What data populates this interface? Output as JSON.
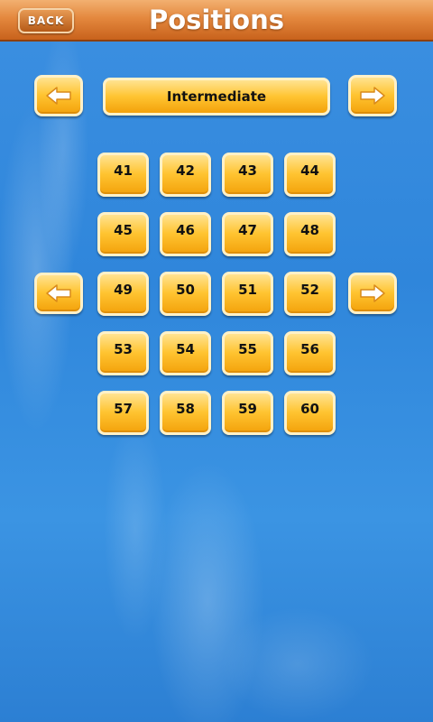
{
  "header": {
    "back_label": "BACK",
    "title": "Positions"
  },
  "level": {
    "name": "Intermediate",
    "prev_icon": "arrow-left-icon",
    "next_icon": "arrow-right-icon"
  },
  "page": {
    "prev_icon": "arrow-left-icon",
    "next_icon": "arrow-right-icon"
  },
  "positions": [
    "41",
    "42",
    "43",
    "44",
    "45",
    "46",
    "47",
    "48",
    "49",
    "50",
    "51",
    "52",
    "53",
    "54",
    "55",
    "56",
    "57",
    "58",
    "59",
    "60"
  ],
  "colors": {
    "header": "#e4883e",
    "button": "#ffc431",
    "sky": "#2f84d9"
  }
}
